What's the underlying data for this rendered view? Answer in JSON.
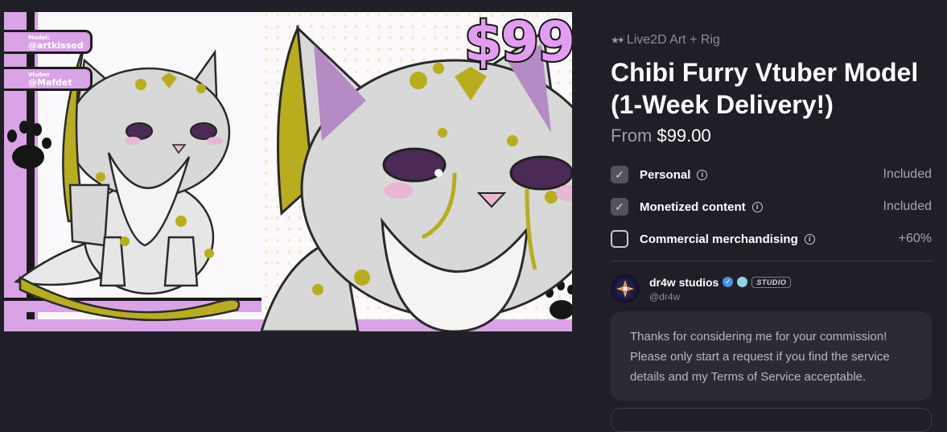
{
  "artwork": {
    "badge_model_label": "Model:",
    "badge_model_value": "@artkissed",
    "badge_vtuber_label": "Vtuber",
    "badge_vtuber_value": "@Mafdet",
    "price_text": "$99"
  },
  "listing": {
    "category_icon": "stars-icon",
    "category": "Live2D Art + Rig",
    "title": "Chibi Furry Vtuber Model (1-Week Delivery!)",
    "price_prefix": "From",
    "price": "$99.00"
  },
  "license_options": [
    {
      "label": "Personal",
      "value": "Included",
      "checked": true
    },
    {
      "label": "Monetized content",
      "value": "Included",
      "checked": true
    },
    {
      "label": "Commercial merchandising",
      "value": "+60%",
      "checked": false
    }
  ],
  "artist": {
    "name": "dr4w studios",
    "handle": "@dr4w",
    "badge": "STUDIO"
  },
  "message": "Thanks for considering me for your commission! Please only start a request if you find the service details and my Terms of Service acceptable.",
  "colors": {
    "background": "#201f28",
    "card": "#2c2b35",
    "accent_pink": "#e39df0",
    "accent_olive": "#b8ad1e",
    "verified_blue": "#4a90e2"
  }
}
